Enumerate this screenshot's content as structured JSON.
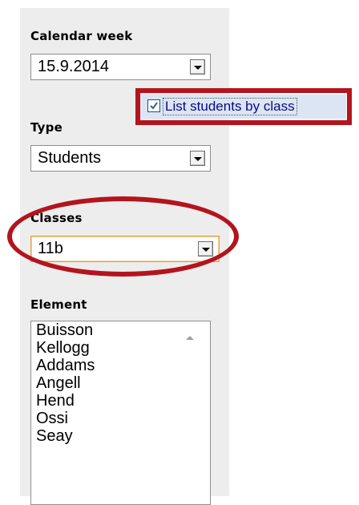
{
  "calendar_week": {
    "label": "Calendar week",
    "value": "15.9.2014"
  },
  "list_by_class": {
    "label": "List students by class",
    "checked": true
  },
  "type": {
    "label": "Type",
    "value": "Students"
  },
  "classes": {
    "label": "Classes",
    "value": "11b"
  },
  "element": {
    "label": "Element",
    "items": [
      "Buisson",
      "Kellogg",
      "Addams",
      "Angell",
      "Hend",
      "Ossi",
      "Seay"
    ]
  },
  "colors": {
    "highlight": "#b3141e",
    "focus": "#e2a03e",
    "selection": "#dce5f4"
  },
  "icons": {
    "dropdown": "chevron-down-icon",
    "check": "check-icon",
    "scroll_up": "scroll-up-icon"
  }
}
